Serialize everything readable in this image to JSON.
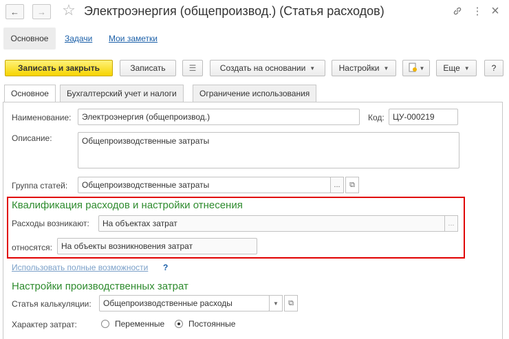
{
  "window": {
    "title": "Электроэнергия (общепроизвод.) (Статья расходов)",
    "back_icon": "←",
    "forward_icon": "→",
    "star_icon": "☆",
    "link_icon": "🔗",
    "menu_icon": "⋮",
    "close_icon": "×"
  },
  "section_tabs": [
    {
      "label": "Основное",
      "active": true
    },
    {
      "label": "Задачи",
      "active": false
    },
    {
      "label": "Мои заметки",
      "active": false
    }
  ],
  "toolbar": {
    "save_close": "Записать и закрыть",
    "save": "Записать",
    "doc_icon": "☰",
    "create_based": "Создать на основании",
    "settings": "Настройки",
    "report_icon": "📄",
    "more": "Еще",
    "help": "?",
    "dropdown_arrow": "▼"
  },
  "form_tabs": [
    "Основное",
    "Бухгалтерский учет и налоги",
    "Ограничение использования"
  ],
  "form": {
    "name_label": "Наименование:",
    "name_value": "Электроэнергия (общепроизвод.)",
    "code_label": "Код:",
    "code_value": "ЦУ-000219",
    "description_label": "Описание:",
    "description_value": "Общепроизводственные затраты",
    "group_label": "Группа статей:",
    "group_value": "Общепроизводственные затраты",
    "ellipsis": "...",
    "open_icon": "⧉"
  },
  "qualification": {
    "header": "Квалификация расходов и настройки отнесения",
    "occur_label": "Расходы возникают:",
    "occur_value": "На объектах затрат",
    "relate_label": "относятся:",
    "relate_value": "На объекты возникновения затрат"
  },
  "full_features": {
    "link": "Использовать полные возможности",
    "help": "?"
  },
  "production": {
    "header": "Настройки производственных затрат",
    "calc_label": "Статья калькуляции:",
    "calc_value": "Общепроизводственные расходы",
    "nature_label": "Характер затрат:",
    "option_variable": "Переменные",
    "option_fixed": "Постоянные",
    "selected": "Постоянные"
  },
  "colors": {
    "accent_green": "#2e8b2e",
    "highlight_red": "#e00000",
    "link_blue": "#1a5fa8",
    "primary_yellow": "#f6d400"
  }
}
